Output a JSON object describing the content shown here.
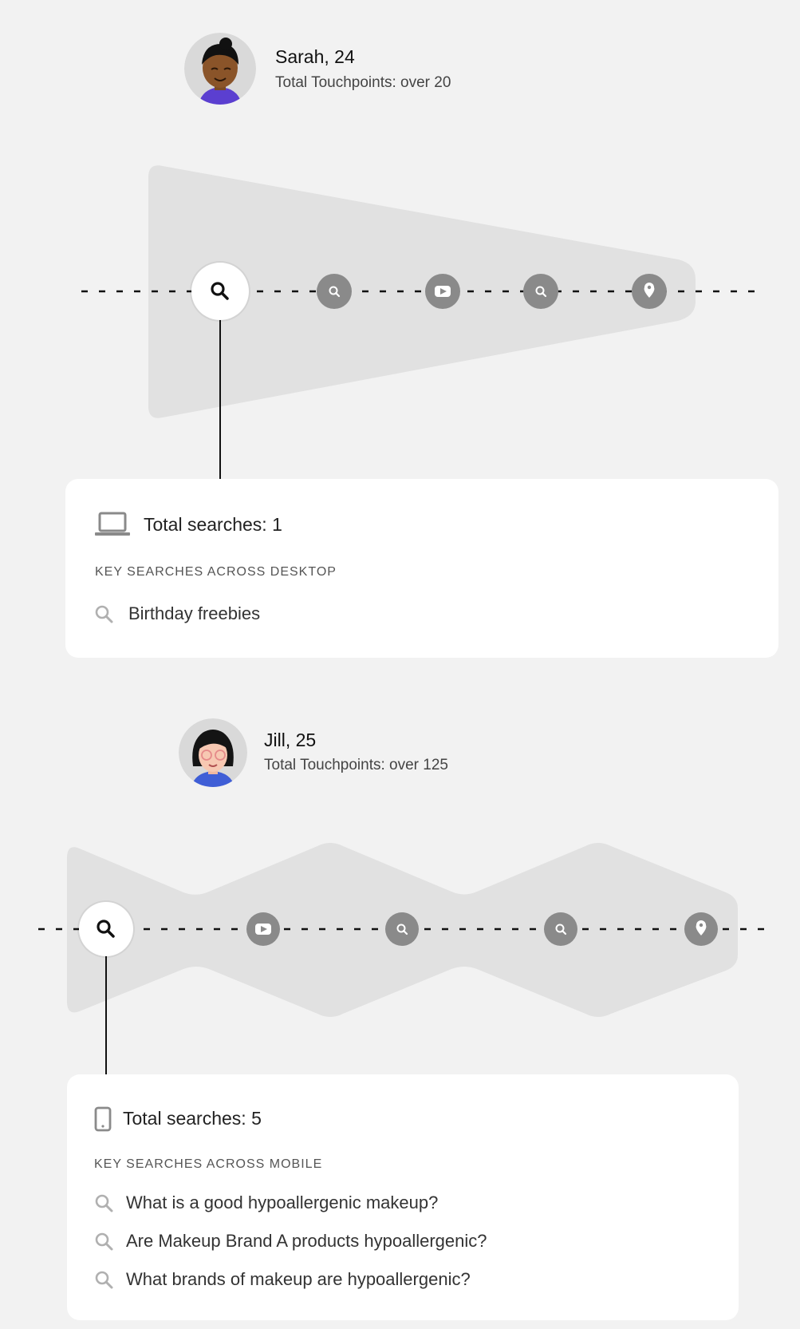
{
  "personas": [
    {
      "name": "Sarah, 24",
      "touchpoints": "Total Touchpoints: over 20",
      "path_nodes": [
        "search-icon",
        "search-icon",
        "video-play-icon",
        "search-icon",
        "map-pin-icon"
      ],
      "card": {
        "device_icon": "laptop-icon",
        "total": "Total searches: 1",
        "caption": "KEY SEARCHES ACROSS DESKTOP",
        "queries": [
          "Birthday freebies"
        ]
      }
    },
    {
      "name": "Jill, 25",
      "touchpoints": "Total Touchpoints: over 125",
      "path_nodes": [
        "search-icon",
        "video-play-icon",
        "search-icon",
        "search-icon",
        "map-pin-icon"
      ],
      "card": {
        "device_icon": "smartphone-icon",
        "total": "Total searches: 5",
        "caption": "KEY SEARCHES ACROSS MOBILE",
        "queries": [
          "What is a good hypoallergenic makeup?",
          "Are Makeup Brand A products hypoallergenic?",
          "What brands of makeup are hypoallergenic?"
        ]
      }
    }
  ],
  "colors": {
    "background": "#f2f2f2",
    "band": "#e1e1e1",
    "node": "#8a8a8a",
    "card": "#ffffff"
  }
}
